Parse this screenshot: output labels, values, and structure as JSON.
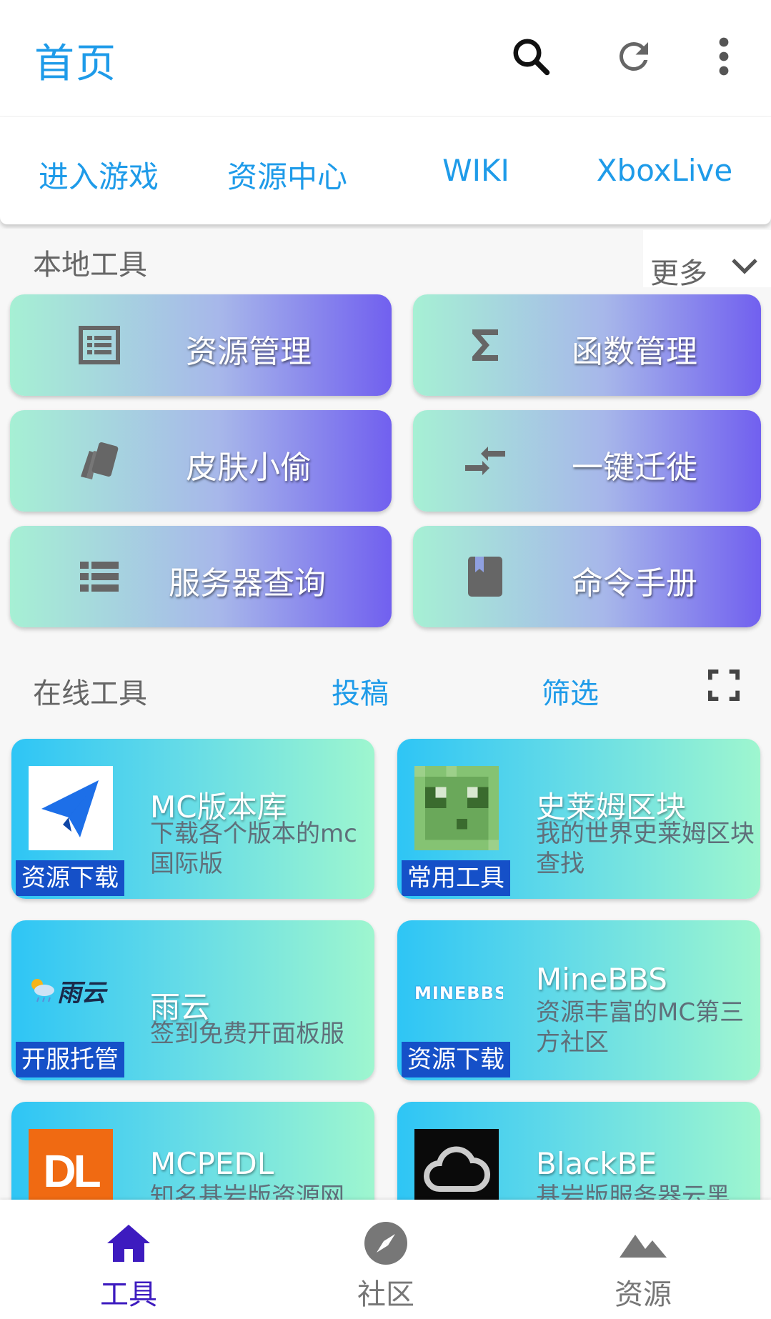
{
  "appbar": {
    "title": "首页",
    "search_icon": "search-icon",
    "refresh_icon": "refresh-icon",
    "more_icon": "more-vert-icon"
  },
  "quicklinks": [
    "进入游戏",
    "资源中心",
    "WIKI",
    "XboxLive"
  ],
  "local_tools": {
    "title": "本地工具",
    "more_label": "更多",
    "items": [
      {
        "label": "资源管理",
        "icon": "list-alt-icon"
      },
      {
        "label": "函数管理",
        "icon": "sigma-icon"
      },
      {
        "label": "皮肤小偷",
        "icon": "cards-icon"
      },
      {
        "label": "一键迁徙",
        "icon": "arrows-compress-icon"
      },
      {
        "label": "服务器查询",
        "icon": "server-list-icon"
      },
      {
        "label": "命令手册",
        "icon": "book-icon"
      }
    ]
  },
  "online_tools": {
    "title": "在线工具",
    "submit_label": "投稿",
    "filter_label": "筛选",
    "items": [
      {
        "title": "MC版本库",
        "desc": "下载各个版本的mc国际版",
        "tag": "资源下载",
        "logo": "paper-plane-logo"
      },
      {
        "title": "史莱姆区块",
        "desc": "我的世界史莱姆区块查找",
        "tag": "常用工具",
        "logo": "slime-logo"
      },
      {
        "title": "雨云",
        "desc": "签到免费开面板服",
        "tag": "开服托管",
        "logo": "rainyun-logo",
        "logo_text": "雨云"
      },
      {
        "title": "MineBBS",
        "desc": "资源丰富的MC第三方社区",
        "tag": "资源下载",
        "logo": "minebbs-logo",
        "logo_text": "MINEBBS"
      },
      {
        "title": "MCPEDL",
        "desc": "知名基岩版资源网",
        "tag": "",
        "logo": "mcpedl-logo",
        "logo_text": "DL"
      },
      {
        "title": "BlackBE",
        "desc": "基岩版服务器云黑",
        "tag": "",
        "logo": "cloud-logo"
      }
    ]
  },
  "bottomnav": {
    "items": [
      {
        "label": "工具",
        "icon": "home-icon",
        "active": true
      },
      {
        "label": "社区",
        "icon": "compass-icon",
        "active": false
      },
      {
        "label": "资源",
        "icon": "mountains-icon",
        "active": false
      }
    ]
  },
  "colors": {
    "accent": "#1e9be9",
    "nav_active": "#3d1bbf",
    "nav_inactive": "#777777",
    "tag_bg": "#1550c8"
  }
}
